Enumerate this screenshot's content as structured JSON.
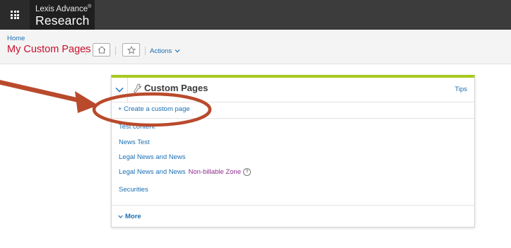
{
  "app": {
    "brand_top": "Lexis Advance",
    "brand_reg": "®",
    "brand_main": "Research"
  },
  "header": {
    "breadcrumb": "Home",
    "title": "My Custom Pages",
    "actions_label": "Actions"
  },
  "panel": {
    "title": "Custom Pages",
    "tips_label": "Tips",
    "create_label": "+ Create a custom page",
    "items": [
      {
        "label": "Test content"
      },
      {
        "label": "News Test"
      },
      {
        "label": "Legal News and News"
      },
      {
        "label": "Legal News and News",
        "badge": "Non-billable Zone",
        "help": "?"
      },
      {
        "label": "Securities"
      }
    ],
    "more_label": "More"
  },
  "annotation": {
    "arrow_color": "#b94a2c",
    "circle_color": "#b94a2c"
  },
  "colors": {
    "accent_bar": "#a8c91e",
    "link": "#1a6fb4",
    "title_red": "#c8102e"
  }
}
